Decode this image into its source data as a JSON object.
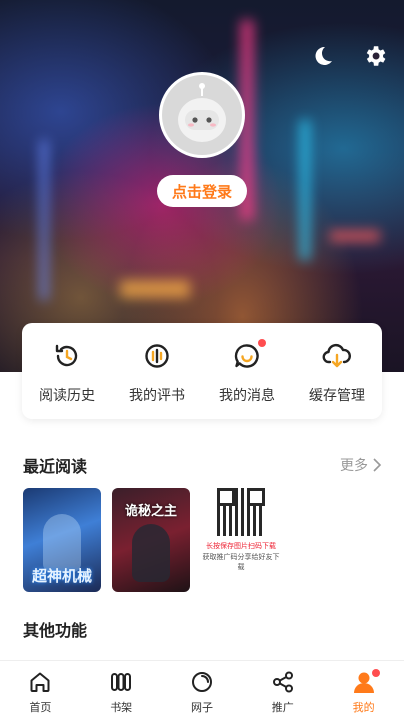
{
  "header": {
    "login_label": "点击登录",
    "icons": {
      "night_mode": "moon-icon",
      "settings": "gear-icon",
      "avatar": "robot-avatar-icon"
    }
  },
  "quick_actions": [
    {
      "label": "阅读历史",
      "icon": "history-icon",
      "has_dot": false
    },
    {
      "label": "我的评书",
      "icon": "review-icon",
      "has_dot": false
    },
    {
      "label": "我的消息",
      "icon": "message-icon",
      "has_dot": true
    },
    {
      "label": "缓存管理",
      "icon": "cloud-download-icon",
      "has_dot": false
    }
  ],
  "recent": {
    "title": "最近阅读",
    "more_label": "更多",
    "books": [
      {
        "title": "超神机械",
        "cover": "cover-blue"
      },
      {
        "title": "诡秘之主",
        "cover": "cover-dark-red"
      }
    ],
    "qr": {
      "line1": "长按保存图片扫码下载",
      "line2": "获取推广码分享给好友下载"
    }
  },
  "other": {
    "title": "其他功能"
  },
  "tabbar": [
    {
      "label": "首页",
      "icon": "home-icon",
      "active": false
    },
    {
      "label": "书架",
      "icon": "bookshelf-icon",
      "active": false
    },
    {
      "label": "网子",
      "icon": "circle-icon",
      "active": false
    },
    {
      "label": "推广",
      "icon": "share-icon",
      "active": false
    },
    {
      "label": "我的",
      "icon": "profile-icon",
      "active": true
    }
  ],
  "colors": {
    "accent": "#ff7a1a",
    "badge": "#ff4d4f"
  }
}
